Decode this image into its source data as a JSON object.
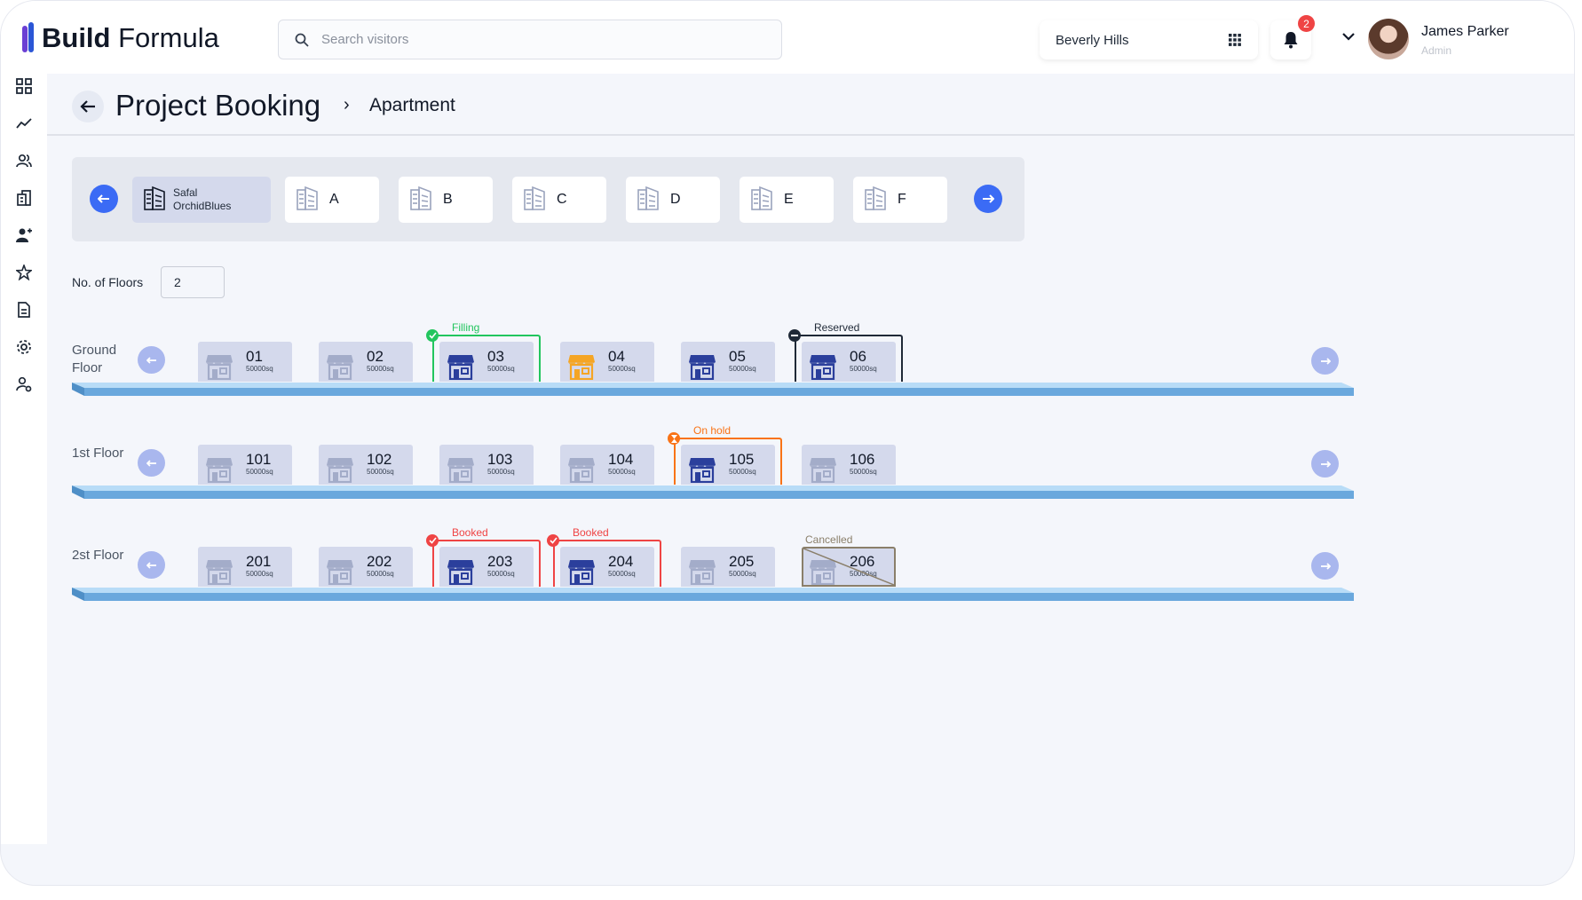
{
  "app": {
    "logo_bold": "Build",
    "logo_light": "Formula"
  },
  "search": {
    "placeholder": "Search visitors"
  },
  "location": {
    "selected": "Beverly Hills"
  },
  "notifications": {
    "count": "2"
  },
  "user": {
    "name": "James Parker",
    "role": "Admin"
  },
  "sidebar": {
    "items": [
      {
        "icon": "dashboard-icon"
      },
      {
        "icon": "analytics-icon"
      },
      {
        "icon": "users-icon"
      },
      {
        "icon": "building-icon"
      },
      {
        "icon": "user-add-icon"
      },
      {
        "icon": "star-icon"
      },
      {
        "icon": "document-icon"
      },
      {
        "icon": "settings-icon"
      },
      {
        "icon": "user-settings-icon"
      }
    ]
  },
  "header": {
    "title": "Project Booking",
    "breadcrumb": "Apartment"
  },
  "towers": [
    {
      "label": "Safal OrchidBlues",
      "active": true
    },
    {
      "label": "A"
    },
    {
      "label": "B"
    },
    {
      "label": "C"
    },
    {
      "label": "D"
    },
    {
      "label": "E"
    },
    {
      "label": "F"
    }
  ],
  "floors_control": {
    "label": "No. of Floors",
    "value": "2"
  },
  "floors": [
    {
      "label": "Ground Floor",
      "units": [
        {
          "no": "01",
          "area": "50000sq",
          "status": ""
        },
        {
          "no": "02",
          "area": "50000sq",
          "status": ""
        },
        {
          "no": "03",
          "area": "50000sq",
          "status": "Filling"
        },
        {
          "no": "04",
          "area": "50000sq",
          "status": ""
        },
        {
          "no": "05",
          "area": "50000sq",
          "status": ""
        },
        {
          "no": "06",
          "area": "50000sq",
          "status": "Reserved"
        }
      ]
    },
    {
      "label": "1st Floor",
      "units": [
        {
          "no": "101",
          "area": "50000sq",
          "status": ""
        },
        {
          "no": "102",
          "area": "50000sq",
          "status": ""
        },
        {
          "no": "103",
          "area": "50000sq",
          "status": ""
        },
        {
          "no": "104",
          "area": "50000sq",
          "status": ""
        },
        {
          "no": "105",
          "area": "50000sq",
          "status": "On hold"
        },
        {
          "no": "106",
          "area": "50000sq",
          "status": ""
        }
      ]
    },
    {
      "label": "2st Floor",
      "units": [
        {
          "no": "201",
          "area": "50000sq",
          "status": ""
        },
        {
          "no": "202",
          "area": "50000sq",
          "status": ""
        },
        {
          "no": "203",
          "area": "50000sq",
          "status": "Booked"
        },
        {
          "no": "204",
          "area": "50000sq",
          "status": "Booked"
        },
        {
          "no": "205",
          "area": "50000sq",
          "status": ""
        },
        {
          "no": "206",
          "area": "50000sq",
          "status": "Cancelled"
        }
      ]
    }
  ],
  "colors": {
    "accent": "#3b6bf5",
    "filling": "#22c55e",
    "reserved": "#1f2937",
    "on_hold": "#f97316",
    "booked": "#ef4444",
    "cancelled": "#8a7f6a",
    "store_active": "#2b3f9c",
    "store_idle": "#a3acc9",
    "store_highlight": "#f5a524"
  }
}
